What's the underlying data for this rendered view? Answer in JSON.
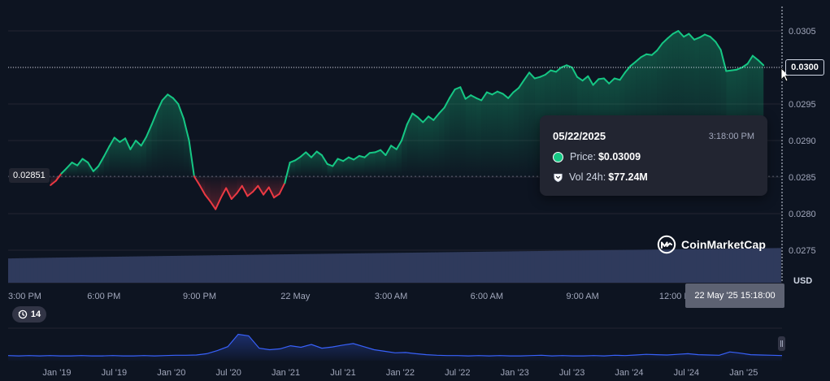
{
  "chart_data": {
    "type": "line",
    "currency_label": "USD",
    "y_axis": {
      "ticks": [
        0.0275,
        0.028,
        0.0285,
        0.029,
        0.0295,
        0.03,
        0.0305
      ],
      "tick_labels": [
        "0.0275",
        "0.0280",
        "0.0285",
        "0.0290",
        "0.0295",
        "0.0300",
        "0.0305"
      ],
      "range": [
        0.02715,
        0.03077
      ]
    },
    "x_axis": {
      "tick_labels": [
        "3:00 PM",
        "6:00 PM",
        "9:00 PM",
        "22 May",
        "3:00 AM",
        "6:00 AM",
        "9:00 AM",
        "12:00 PM"
      ],
      "tick_hours": [
        15,
        18,
        21,
        24,
        27,
        30,
        33,
        36
      ],
      "range_hours": [
        15,
        39.25
      ]
    },
    "reference_line": {
      "value": 0.02851,
      "label": "0.02851"
    },
    "current_price": {
      "value": 0.03,
      "label": "0.0300"
    },
    "crosshair": {
      "label": "22 May '25 15:18:00"
    },
    "price_series": {
      "name": "Price",
      "colors": {
        "up": "#16c784",
        "down": "#ea3943"
      },
      "points": [
        [
          16.33,
          0.02839
        ],
        [
          16.5,
          0.02845
        ],
        [
          16.67,
          0.02855
        ],
        [
          16.83,
          0.02862
        ],
        [
          17.0,
          0.0287
        ],
        [
          17.17,
          0.02866
        ],
        [
          17.33,
          0.02875
        ],
        [
          17.5,
          0.0287
        ],
        [
          17.67,
          0.02858
        ],
        [
          17.83,
          0.02865
        ],
        [
          18.0,
          0.02878
        ],
        [
          18.17,
          0.02892
        ],
        [
          18.33,
          0.02904
        ],
        [
          18.5,
          0.02898
        ],
        [
          18.67,
          0.02903
        ],
        [
          18.83,
          0.02888
        ],
        [
          19.0,
          0.029
        ],
        [
          19.17,
          0.02893
        ],
        [
          19.33,
          0.02905
        ],
        [
          19.5,
          0.02922
        ],
        [
          19.67,
          0.0294
        ],
        [
          19.83,
          0.02955
        ],
        [
          20.0,
          0.02963
        ],
        [
          20.17,
          0.02958
        ],
        [
          20.33,
          0.0295
        ],
        [
          20.5,
          0.0293
        ],
        [
          20.67,
          0.029
        ],
        [
          20.83,
          0.02851
        ],
        [
          21.0,
          0.02839
        ],
        [
          21.17,
          0.02826
        ],
        [
          21.33,
          0.02817
        ],
        [
          21.5,
          0.02806
        ],
        [
          21.67,
          0.02822
        ],
        [
          21.83,
          0.02835
        ],
        [
          22.0,
          0.0282
        ],
        [
          22.17,
          0.02828
        ],
        [
          22.33,
          0.02838
        ],
        [
          22.5,
          0.02824
        ],
        [
          22.67,
          0.0283
        ],
        [
          22.83,
          0.02838
        ],
        [
          23.0,
          0.02826
        ],
        [
          23.17,
          0.02836
        ],
        [
          23.33,
          0.02822
        ],
        [
          23.5,
          0.02827
        ],
        [
          23.67,
          0.02842
        ],
        [
          23.83,
          0.0287
        ],
        [
          24.0,
          0.02873
        ],
        [
          24.17,
          0.02878
        ],
        [
          24.33,
          0.02884
        ],
        [
          24.5,
          0.02877
        ],
        [
          24.67,
          0.02885
        ],
        [
          24.83,
          0.0288
        ],
        [
          25.0,
          0.02868
        ],
        [
          25.17,
          0.02865
        ],
        [
          25.33,
          0.02875
        ],
        [
          25.5,
          0.02872
        ],
        [
          25.67,
          0.02877
        ],
        [
          25.83,
          0.02874
        ],
        [
          26.0,
          0.02879
        ],
        [
          26.17,
          0.02877
        ],
        [
          26.33,
          0.02883
        ],
        [
          26.5,
          0.02884
        ],
        [
          26.67,
          0.02887
        ],
        [
          26.83,
          0.0288
        ],
        [
          27.0,
          0.02893
        ],
        [
          27.17,
          0.02888
        ],
        [
          27.33,
          0.029
        ],
        [
          27.5,
          0.02922
        ],
        [
          27.67,
          0.02937
        ],
        [
          27.83,
          0.02932
        ],
        [
          28.0,
          0.02925
        ],
        [
          28.17,
          0.02933
        ],
        [
          28.33,
          0.02928
        ],
        [
          28.5,
          0.02937
        ],
        [
          28.67,
          0.02945
        ],
        [
          28.83,
          0.02958
        ],
        [
          29.0,
          0.0297
        ],
        [
          29.17,
          0.02973
        ],
        [
          29.33,
          0.02957
        ],
        [
          29.5,
          0.02962
        ],
        [
          29.67,
          0.02958
        ],
        [
          29.83,
          0.02955
        ],
        [
          30.0,
          0.02966
        ],
        [
          30.17,
          0.02963
        ],
        [
          30.33,
          0.02967
        ],
        [
          30.5,
          0.02964
        ],
        [
          30.67,
          0.02958
        ],
        [
          30.83,
          0.02966
        ],
        [
          31.0,
          0.02972
        ],
        [
          31.17,
          0.02983
        ],
        [
          31.33,
          0.02993
        ],
        [
          31.5,
          0.02985
        ],
        [
          31.67,
          0.02987
        ],
        [
          31.83,
          0.0299
        ],
        [
          32.0,
          0.02996
        ],
        [
          32.17,
          0.02994
        ],
        [
          32.33,
          0.03
        ],
        [
          32.5,
          0.03003
        ],
        [
          32.67,
          0.03
        ],
        [
          32.83,
          0.02987
        ],
        [
          33.0,
          0.02982
        ],
        [
          33.17,
          0.02988
        ],
        [
          33.33,
          0.02976
        ],
        [
          33.5,
          0.02984
        ],
        [
          33.67,
          0.02985
        ],
        [
          33.83,
          0.02978
        ],
        [
          34.0,
          0.02985
        ],
        [
          34.17,
          0.02983
        ],
        [
          34.33,
          0.02993
        ],
        [
          34.5,
          0.03002
        ],
        [
          34.67,
          0.03008
        ],
        [
          34.83,
          0.03014
        ],
        [
          35.0,
          0.03018
        ],
        [
          35.17,
          0.03017
        ],
        [
          35.33,
          0.03023
        ],
        [
          35.5,
          0.03033
        ],
        [
          35.67,
          0.0304
        ],
        [
          35.83,
          0.03046
        ],
        [
          36.0,
          0.0305
        ],
        [
          36.17,
          0.03042
        ],
        [
          36.33,
          0.03046
        ],
        [
          36.5,
          0.03038
        ],
        [
          36.67,
          0.03041
        ],
        [
          36.83,
          0.03045
        ],
        [
          37.0,
          0.03042
        ],
        [
          37.17,
          0.03035
        ],
        [
          37.33,
          0.03024
        ],
        [
          37.5,
          0.02995
        ],
        [
          37.67,
          0.02996
        ],
        [
          37.83,
          0.02997
        ],
        [
          38.0,
          0.03
        ],
        [
          38.17,
          0.03005
        ],
        [
          38.33,
          0.03016
        ],
        [
          38.5,
          0.0301
        ],
        [
          38.67,
          0.03003
        ]
      ]
    },
    "volume_series": {
      "name": "Vol 24h",
      "start_level": 0.28,
      "end_level": 0.4
    },
    "navigator": {
      "tick_labels": [
        "Jan '19",
        "Jul '19",
        "Jan '20",
        "Jul '20",
        "Jan '21",
        "Jul '21",
        "Jan '22",
        "Jul '22",
        "Jan '23",
        "Jul '23",
        "Jan '24",
        "Jul '24",
        "Jan '25"
      ],
      "profile": [
        0.06,
        0.05,
        0.06,
        0.05,
        0.06,
        0.05,
        0.05,
        0.06,
        0.05,
        0.05,
        0.06,
        0.05,
        0.05,
        0.06,
        0.05,
        0.06,
        0.07,
        0.07,
        0.08,
        0.12,
        0.22,
        0.35,
        0.75,
        0.7,
        0.3,
        0.25,
        0.28,
        0.38,
        0.33,
        0.42,
        0.3,
        0.34,
        0.4,
        0.45,
        0.35,
        0.25,
        0.2,
        0.15,
        0.16,
        0.12,
        0.09,
        0.07,
        0.06,
        0.06,
        0.05,
        0.06,
        0.05,
        0.06,
        0.05,
        0.05,
        0.06,
        0.07,
        0.05,
        0.06,
        0.05,
        0.05,
        0.06,
        0.05,
        0.07,
        0.06,
        0.08,
        0.1,
        0.09,
        0.08,
        0.1,
        0.12,
        0.09,
        0.08,
        0.07,
        0.18,
        0.14,
        0.09,
        0.08,
        0.07,
        0.06
      ]
    }
  },
  "tooltip": {
    "date": "05/22/2025",
    "time": "3:18:00 PM",
    "price_label": "Price:",
    "price_value": "$0.03009",
    "vol_label": "Vol 24h:",
    "vol_value": "$77.24M"
  },
  "zoom_badge": {
    "count": "14",
    "icon": "history-icon"
  },
  "brand": {
    "name": "CoinMarketCap",
    "icon": "coinmarketcap-logo-icon"
  },
  "colors": {
    "background": "#0d1421",
    "grid": "#222531",
    "up": "#16c784",
    "down": "#ea3943",
    "volume": "#2f3a5c",
    "navigator_line": "#3861fb",
    "axis_text": "#a1a7bb"
  }
}
